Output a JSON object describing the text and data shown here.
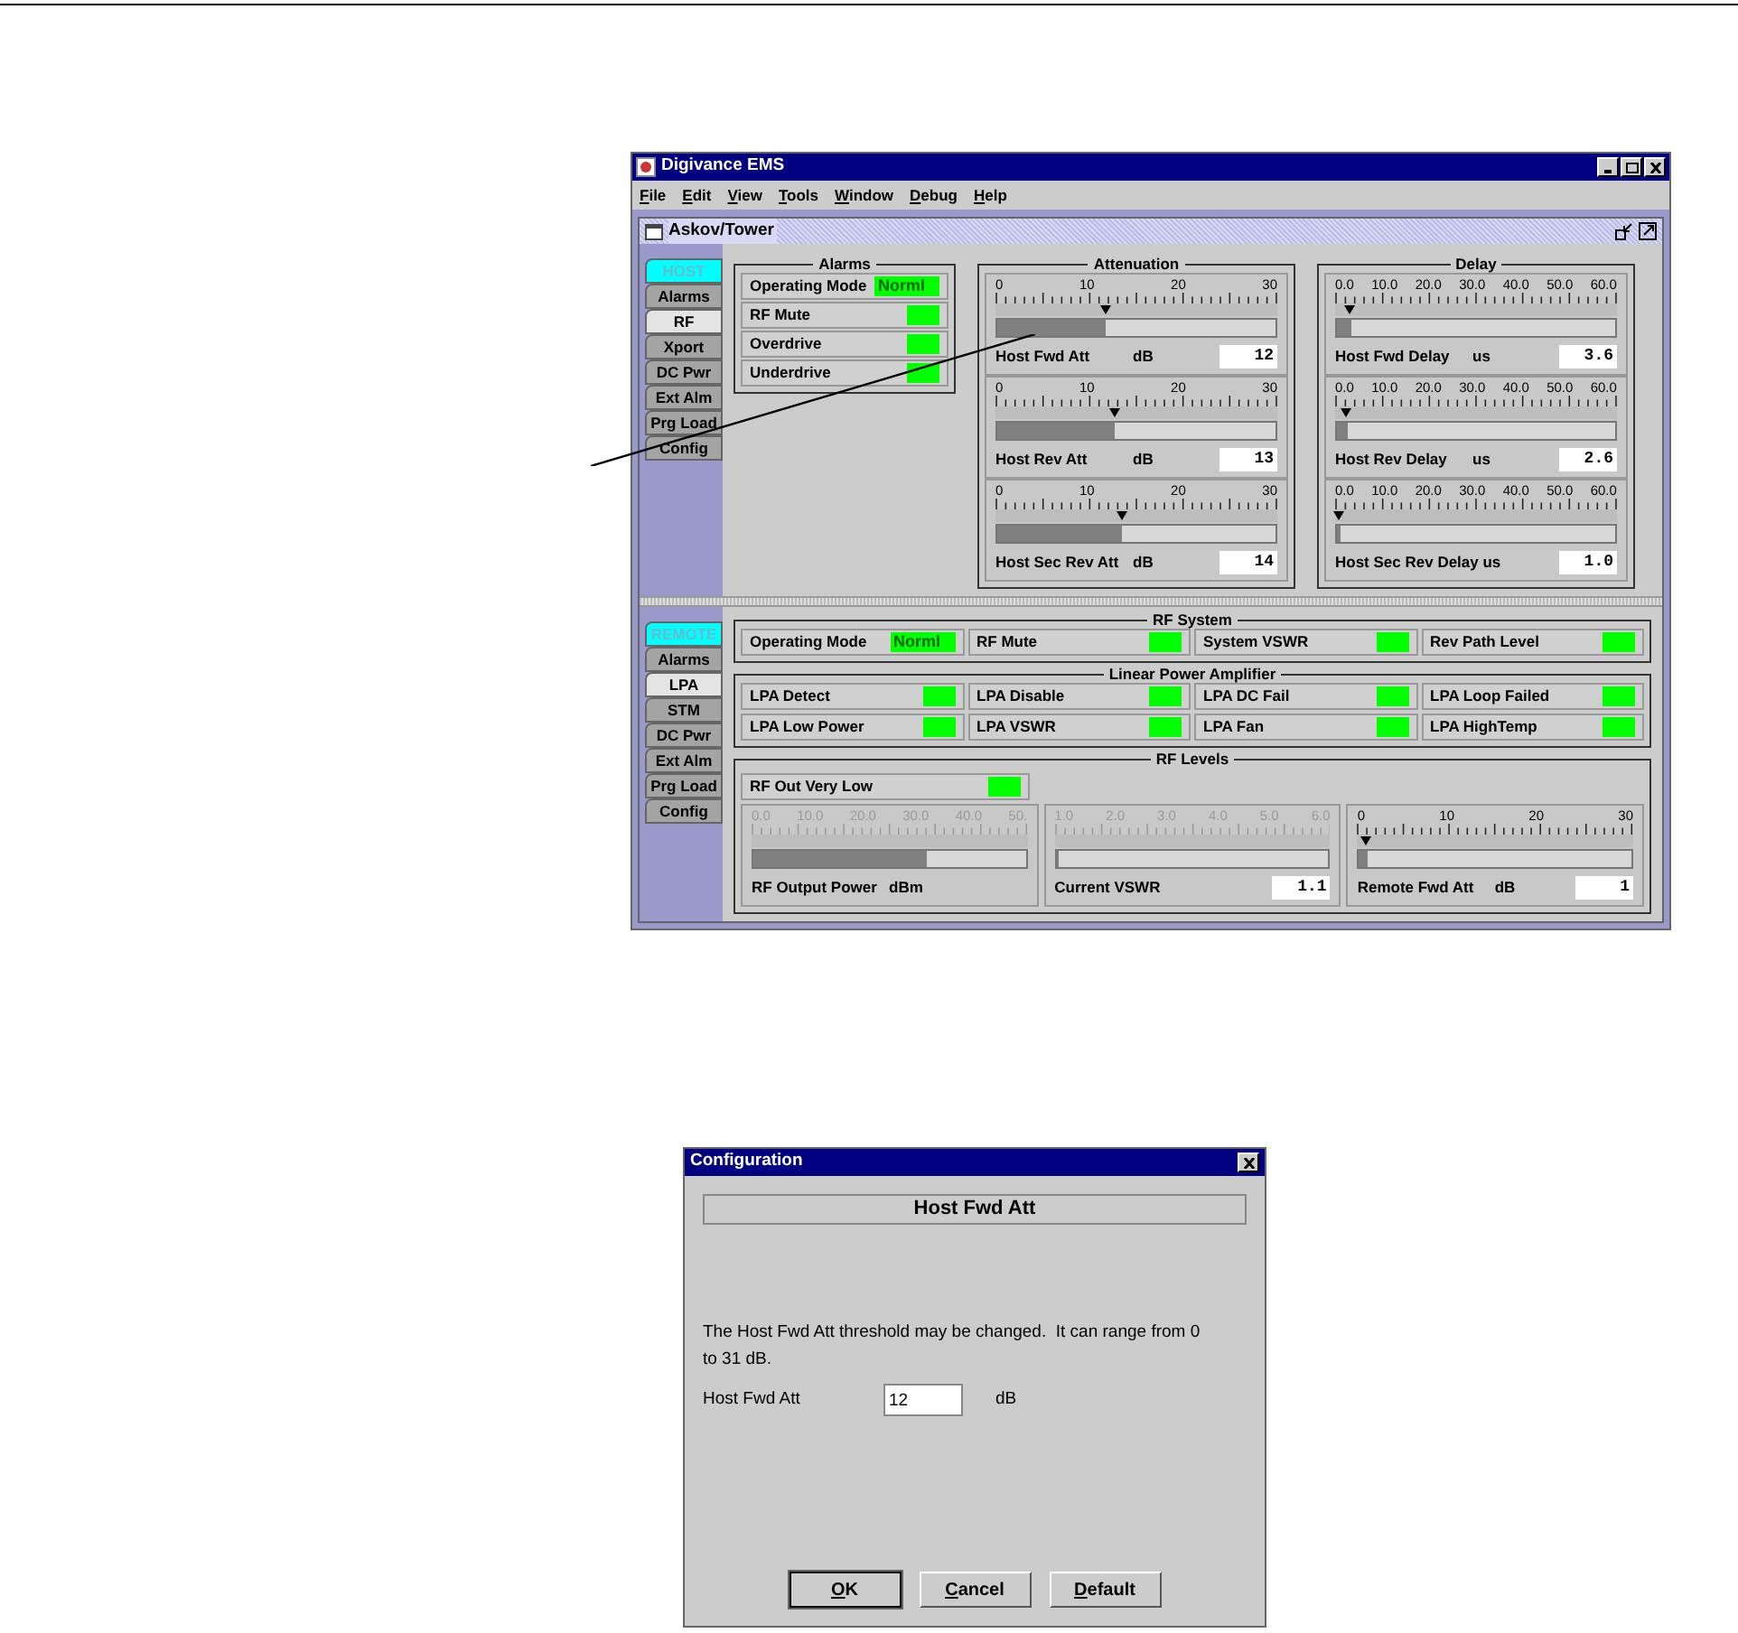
{
  "window": {
    "title": "Digivance EMS",
    "menu": [
      "File",
      "Edit",
      "View",
      "Tools",
      "Window",
      "Debug",
      "Help"
    ]
  },
  "frame": {
    "title": "Askov/Tower"
  },
  "host": {
    "tabs": [
      {
        "label": "HOST",
        "kind": "header",
        "selected": false
      },
      {
        "label": "Alarms",
        "kind": "tab",
        "selected": false
      },
      {
        "label": "RF",
        "kind": "tab",
        "selected": true
      },
      {
        "label": "Xport",
        "kind": "tab",
        "selected": false
      },
      {
        "label": "DC Pwr",
        "kind": "tab",
        "selected": false
      },
      {
        "label": "Ext Alm",
        "kind": "tab",
        "selected": false
      },
      {
        "label": "Prg Load",
        "kind": "tab",
        "selected": false
      },
      {
        "label": "Config",
        "kind": "tab",
        "selected": false
      }
    ],
    "alarms": {
      "title": "Alarms",
      "items": [
        {
          "label": "Operating Mode",
          "indicator": "Norml"
        },
        {
          "label": "RF Mute"
        },
        {
          "label": "Overdrive"
        },
        {
          "label": "Underdrive"
        }
      ]
    },
    "attenuation": {
      "title": "Attenuation",
      "gauges": [
        {
          "scale": [
            "0",
            "10",
            "20",
            "30"
          ],
          "level": 0.39,
          "label": "Host Fwd Att",
          "unit": "dB",
          "value": "12",
          "dimmed": false
        },
        {
          "scale": [
            "0",
            "10",
            "20",
            "30"
          ],
          "level": 0.42,
          "label": "Host Rev Att",
          "unit": "dB",
          "value": "13",
          "dimmed": false
        },
        {
          "scale": [
            "0",
            "10",
            "20",
            "30"
          ],
          "level": 0.45,
          "label": "Host Sec Rev Att",
          "unit": "dB",
          "value": "14",
          "dimmed": false
        }
      ]
    },
    "delay": {
      "title": "Delay",
      "gauges": [
        {
          "scale": [
            "0.0",
            "10.0",
            "20.0",
            "30.0",
            "40.0",
            "50.0",
            "60.0"
          ],
          "level": 0.05,
          "label": "Host Fwd Delay",
          "unit": "us",
          "value": "3.6",
          "dimmed": false
        },
        {
          "scale": [
            "0.0",
            "10.0",
            "20.0",
            "30.0",
            "40.0",
            "50.0",
            "60.0"
          ],
          "level": 0.04,
          "label": "Host Rev Delay",
          "unit": "us",
          "value": "2.6",
          "dimmed": false
        },
        {
          "scale": [
            "0.0",
            "10.0",
            "20.0",
            "30.0",
            "40.0",
            "50.0",
            "60.0"
          ],
          "level": 0.01,
          "label": "Host Sec Rev Delay us",
          "value": "1.0",
          "dimmed": false
        }
      ]
    }
  },
  "remote": {
    "tabs": [
      {
        "label": "REMOTE",
        "kind": "header",
        "selected": false
      },
      {
        "label": "Alarms",
        "kind": "tab",
        "selected": false
      },
      {
        "label": "LPA",
        "kind": "tab",
        "selected": true
      },
      {
        "label": "STM",
        "kind": "tab",
        "selected": false
      },
      {
        "label": "DC Pwr",
        "kind": "tab",
        "selected": false
      },
      {
        "label": "Ext Alm",
        "kind": "tab",
        "selected": false
      },
      {
        "label": "Prg Load",
        "kind": "tab",
        "selected": false
      },
      {
        "label": "Config",
        "kind": "tab",
        "selected": false
      }
    ],
    "rf_system": {
      "title": "RF System",
      "items": [
        {
          "label": "Operating Mode",
          "indicator": "Norml"
        },
        {
          "label": "RF Mute"
        },
        {
          "label": "System VSWR"
        },
        {
          "label": "Rev Path Level"
        }
      ]
    },
    "lpa": {
      "title": "Linear Power Amplifier",
      "items": [
        {
          "label": "LPA Detect"
        },
        {
          "label": "LPA Disable"
        },
        {
          "label": "LPA DC Fail"
        },
        {
          "label": "LPA Loop Failed"
        },
        {
          "label": "LPA Low Power"
        },
        {
          "label": "LPA VSWR"
        },
        {
          "label": "LPA Fan"
        },
        {
          "label": "LPA HighTemp"
        }
      ]
    },
    "rf_levels": {
      "title": "RF Levels",
      "alarm": {
        "label": "RF Out Very Low"
      },
      "gauges": [
        {
          "scale": [
            "0.0",
            "10.0",
            "20.0",
            "30.0",
            "40.0",
            "50."
          ],
          "level": 0.64,
          "label": "RF Output Power",
          "unit": "dBm",
          "dimmed": true
        },
        {
          "scale": [
            "1.0",
            "2.0",
            "3.0",
            "4.0",
            "5.0",
            "6.0"
          ],
          "level": 0.01,
          "label": "Current VSWR",
          "value": "1.1",
          "dimmed": true
        },
        {
          "scale": [
            "0",
            "10",
            "20",
            "30"
          ],
          "level": 0.03,
          "label": "Remote Fwd Att",
          "unit": "dB",
          "value": "1",
          "dimmed": false
        }
      ]
    }
  },
  "dialog": {
    "title": "Configuration",
    "heading": "Host Fwd Att",
    "message": "The Host Fwd Att threshold may be changed.  It can range from 0 to 31 dB.",
    "field": {
      "label": "Host Fwd Att",
      "value": "12",
      "unit": "dB"
    },
    "buttons": [
      "OK",
      "Cancel",
      "Default"
    ]
  }
}
